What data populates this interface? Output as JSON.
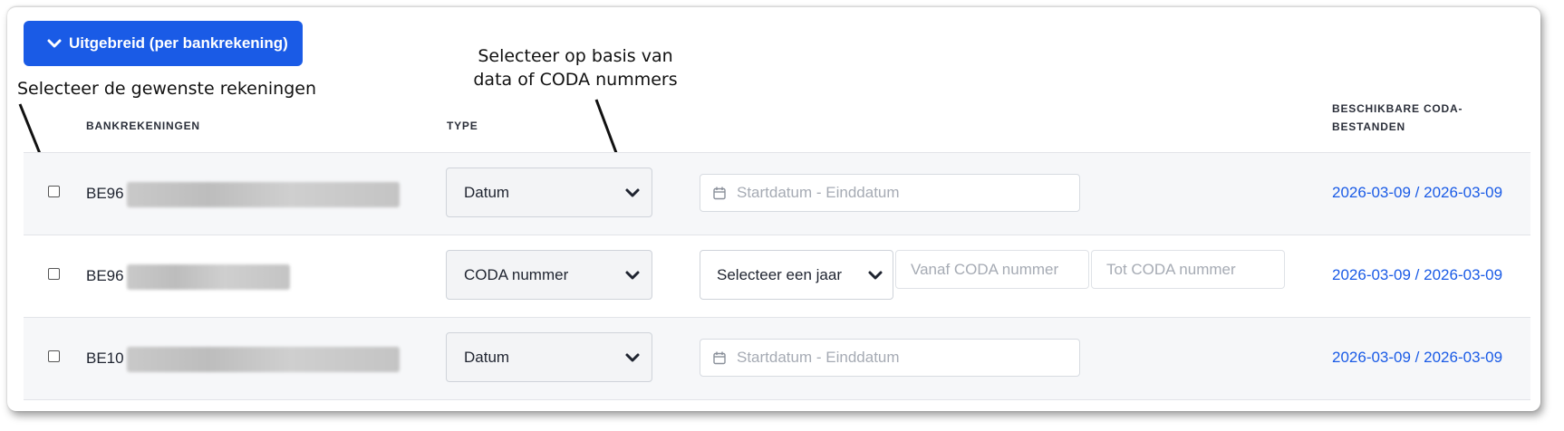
{
  "toggle": {
    "label": "Uitgebreid (per bankrekening)"
  },
  "annotations": {
    "left": "Selecteer de gewenste rekeningen",
    "center_line1": "Selecteer op basis van",
    "center_line2": "data of CODA nummers"
  },
  "table": {
    "headers": {
      "accounts": "BANKREKENINGEN",
      "type": "TYPE",
      "files_line1": "BESCHIKBARE CODA-",
      "files_line2": "BESTANDEN"
    },
    "rows": [
      {
        "account_prefix": "BE96",
        "type": "Datum",
        "date_placeholder": "Startdatum - Einddatum",
        "files": "2026-03-09 / 2026-03-09"
      },
      {
        "account_prefix": "BE96",
        "type": "CODA nummer",
        "year_select": "Selecteer een jaar",
        "from_placeholder": "Vanaf CODA nummer",
        "to_placeholder": "Tot CODA nummer",
        "files": "2026-03-09 / 2026-03-09"
      },
      {
        "account_prefix": "BE10",
        "type": "Datum",
        "date_placeholder": "Startdatum - Einddatum",
        "files": "2026-03-09 / 2026-03-09"
      }
    ]
  },
  "colors": {
    "primary": "#1a5be6",
    "row_alt": "#f6f7f9"
  },
  "icons": [
    "chevron-down-icon",
    "calendar-icon",
    "arrow-icon"
  ]
}
